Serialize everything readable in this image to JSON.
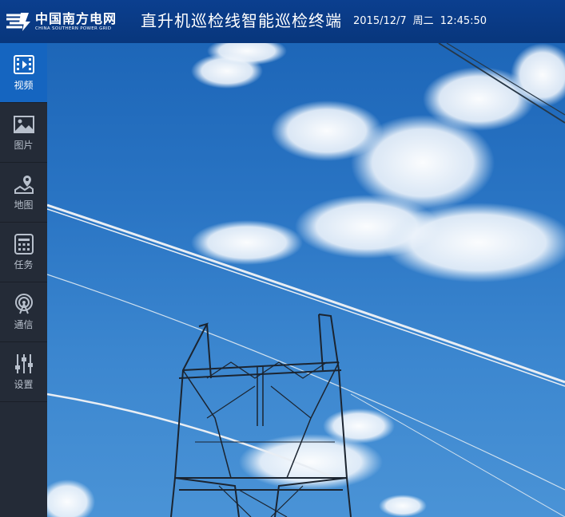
{
  "header": {
    "brand_cn": "中国南方电网",
    "brand_en": "CHINA SOUTHERN POWER GRID",
    "app_title": "直升机巡检线智能巡检终端",
    "date": "2015/12/7",
    "weekday": "周二",
    "time": "12:45:50"
  },
  "sidebar": {
    "items": [
      {
        "label": "视频",
        "icon": "video-icon",
        "active": true
      },
      {
        "label": "图片",
        "icon": "image-icon",
        "active": false
      },
      {
        "label": "地图",
        "icon": "map-icon",
        "active": false
      },
      {
        "label": "任务",
        "icon": "task-icon",
        "active": false
      },
      {
        "label": "通信",
        "icon": "signal-icon",
        "active": false
      },
      {
        "label": "设置",
        "icon": "settings-icon",
        "active": false
      }
    ]
  },
  "colors": {
    "header_bg": "#0b3f8f",
    "sidebar_bg": "#242b37",
    "active_item": "#1565c0",
    "sky": "#2a75c4"
  }
}
